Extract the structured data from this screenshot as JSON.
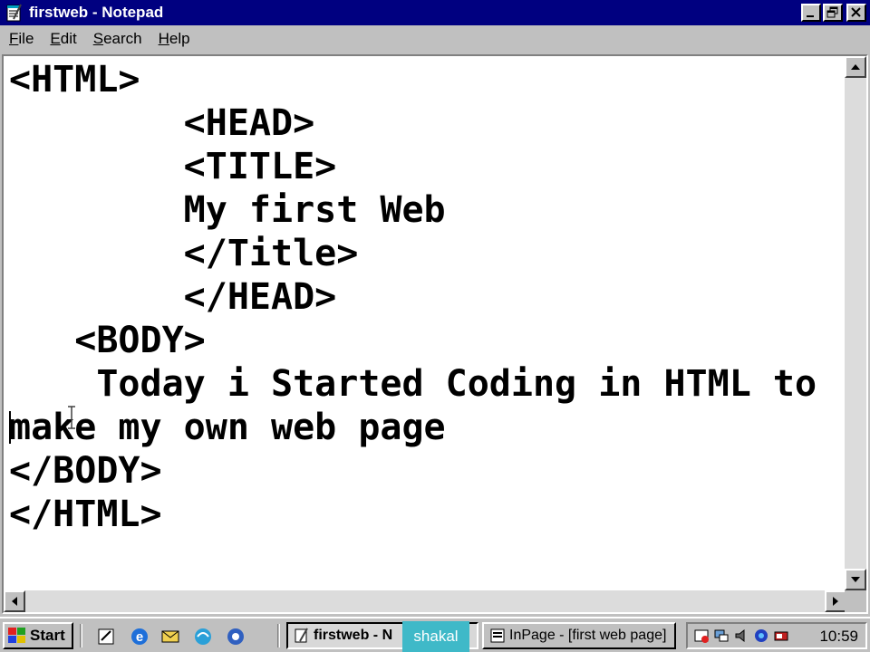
{
  "window": {
    "title": "firstweb - Notepad",
    "menu": [
      {
        "label": "File",
        "accel": "F",
        "rest": "ile"
      },
      {
        "label": "Edit",
        "accel": "E",
        "rest": "dit"
      },
      {
        "label": "Search",
        "accel": "S",
        "rest": "earch"
      },
      {
        "label": "Help",
        "accel": "H",
        "rest": "elp"
      }
    ]
  },
  "editor": {
    "lines": [
      "<HTML>",
      "        <HEAD>",
      "        <TITLE>",
      "        My first Web",
      "        </Title>",
      "        </HEAD>",
      "   <BODY>",
      "    Today i Started Coding in HTML to",
      "make my own web page",
      "</BODY>",
      "</HTML>"
    ]
  },
  "taskbar": {
    "start_label": "Start",
    "tasks": [
      {
        "label": "firstweb - N",
        "active": true
      },
      {
        "label": "InPage - [first web page]",
        "active": false
      }
    ],
    "overlay_text": "shakal",
    "clock": "10:59"
  },
  "colors": {
    "titlebar": "#000080",
    "chrome": "#c0c0c0",
    "overlay": "#3fb9c8"
  }
}
